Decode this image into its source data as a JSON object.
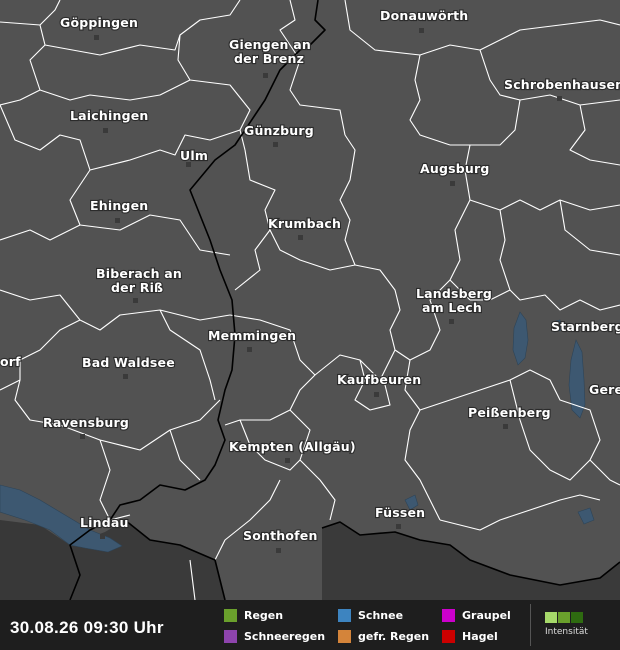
{
  "map": {
    "cities": [
      {
        "id": "goeppingen",
        "name": "Göppingen"
      },
      {
        "id": "giengen1",
        "name": "Giengen an"
      },
      {
        "id": "giengen2",
        "name": "der Brenz"
      },
      {
        "id": "donauwoerth",
        "name": "Donauwörth"
      },
      {
        "id": "schrobenhausen",
        "name": "Schrobenhausen"
      },
      {
        "id": "laichingen",
        "name": "Laichingen"
      },
      {
        "id": "guenzburg",
        "name": "Günzburg"
      },
      {
        "id": "ulm",
        "name": "Ulm"
      },
      {
        "id": "augsburg",
        "name": "Augsburg"
      },
      {
        "id": "ehingen",
        "name": "Ehingen"
      },
      {
        "id": "krumbach",
        "name": "Krumbach"
      },
      {
        "id": "biberach1",
        "name": "Biberach an"
      },
      {
        "id": "biberach2",
        "name": "der Riß"
      },
      {
        "id": "landsberg1",
        "name": "Landsberg"
      },
      {
        "id": "landsberg2",
        "name": "am Lech"
      },
      {
        "id": "starnberg",
        "name": "Starnberg"
      },
      {
        "id": "memmingen",
        "name": "Memmingen"
      },
      {
        "id": "orf",
        "name": "orf"
      },
      {
        "id": "badwaldsee",
        "name": "Bad Waldsee"
      },
      {
        "id": "kaufbeuren",
        "name": "Kaufbeuren"
      },
      {
        "id": "gere",
        "name": "Gere"
      },
      {
        "id": "ravensburg",
        "name": "Ravensburg"
      },
      {
        "id": "peissenberg",
        "name": "Peißenberg"
      },
      {
        "id": "kempten",
        "name": "Kempten (Allgäu)"
      },
      {
        "id": "fuessen",
        "name": "Füssen"
      },
      {
        "id": "lindau",
        "name": "Lindau"
      },
      {
        "id": "sonthofen",
        "name": "Sonthofen"
      }
    ]
  },
  "footer": {
    "timestamp": "30.08.26 09:30 Uhr",
    "legend": [
      {
        "label": "Regen",
        "color": "#6aa02c"
      },
      {
        "label": "Schneeregen",
        "color": "#8e44ad"
      },
      {
        "label": "Schnee",
        "color": "#3d84c0"
      },
      {
        "label": "gefr. Regen",
        "color": "#d4843a"
      },
      {
        "label": "Graupel",
        "color": "#cc00cc"
      },
      {
        "label": "Hagel",
        "color": "#cc0000"
      }
    ],
    "intensity_label": "Intensität",
    "intensity_colors": [
      "#a6d96a",
      "#6aa02c",
      "#2e6b10"
    ]
  }
}
